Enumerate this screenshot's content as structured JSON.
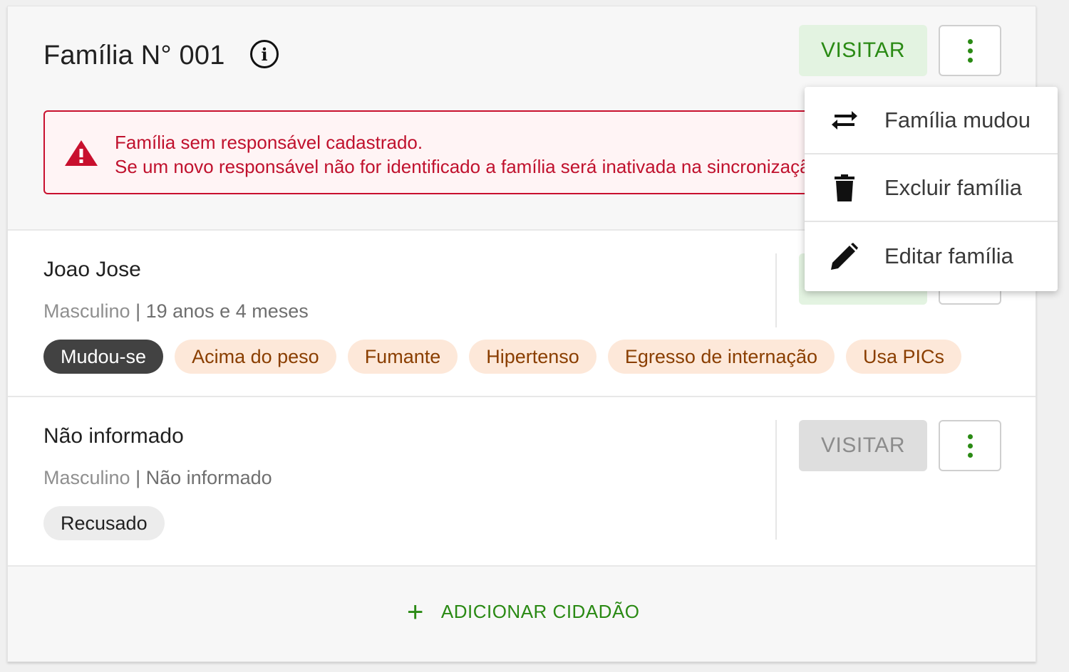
{
  "family": {
    "title": "Família N° 001",
    "visit_label": "VISITAR",
    "alert": {
      "line1": "Família sem responsável cadastrado.",
      "line2": "Se um novo responsável não for identificado a família será inativada na sincronização."
    }
  },
  "members": [
    {
      "name": "Joao Jose",
      "gender": "Masculino",
      "age": "19 anos e 4 meses",
      "visit_label": "VISITAR",
      "tags": [
        {
          "label": "Mudou-se",
          "style": "dark"
        },
        {
          "label": "Acima do peso",
          "style": "orange"
        },
        {
          "label": "Fumante",
          "style": "orange"
        },
        {
          "label": "Hipertenso",
          "style": "orange"
        },
        {
          "label": "Egresso de internação",
          "style": "orange"
        },
        {
          "label": "Usa PICs",
          "style": "orange"
        }
      ]
    },
    {
      "name": "Não informado",
      "gender": "Masculino",
      "age": "Não informado",
      "visit_label": "VISITAR",
      "tags": [
        {
          "label": "Recusado",
          "style": "grey"
        }
      ]
    }
  ],
  "add_citizen_label": "ADICIONAR CIDADÃO",
  "menu": {
    "items": [
      {
        "label": "Família mudou",
        "icon": "swap-icon"
      },
      {
        "label": "Excluir família",
        "icon": "trash-icon"
      },
      {
        "label": "Editar família",
        "icon": "pencil-icon"
      }
    ]
  },
  "colors": {
    "accent": "#2a8a14",
    "danger": "#c8102e"
  }
}
